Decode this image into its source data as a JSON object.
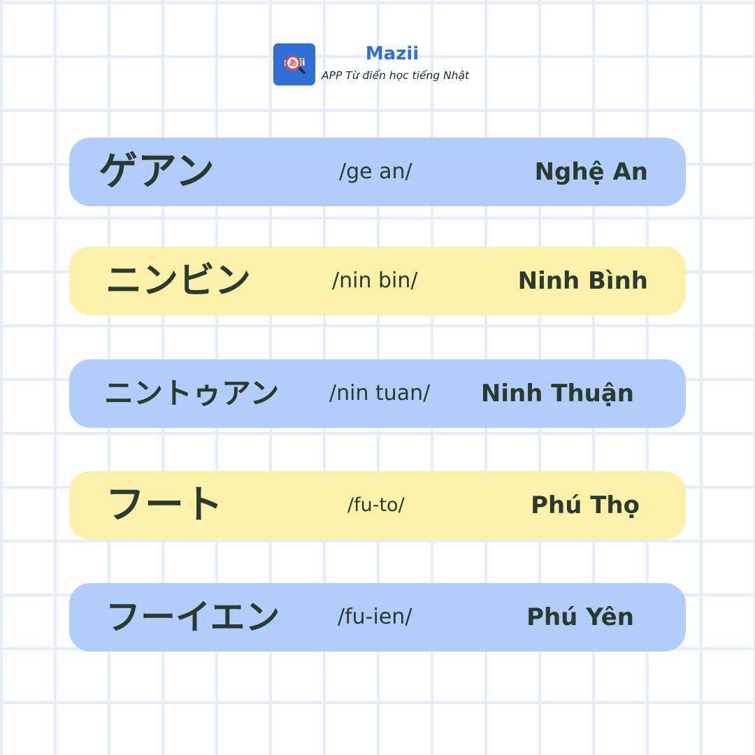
{
  "header": {
    "logo_text": "mzii",
    "logo_char": "あ",
    "brand": "Mazii",
    "tagline": "APP Từ điển học tiếng Nhật"
  },
  "colors": {
    "blue_card": "#b3cdfb",
    "yellow_card": "#fdf1a9",
    "text": "#2a3a2e",
    "brand": "#2f6fd6"
  },
  "rows": [
    {
      "japanese": "ゲアン",
      "romaji": "/ge an/",
      "vietnamese": "Nghệ An"
    },
    {
      "japanese": "ニンビン",
      "romaji": "/nin bin/",
      "vietnamese": "Ninh Bình"
    },
    {
      "japanese": "ニントゥアン",
      "romaji": "/nin tuan/",
      "vietnamese": "Ninh Thuận"
    },
    {
      "japanese": "フート",
      "romaji": "/fu-to/",
      "vietnamese": "Phú Thọ"
    },
    {
      "japanese": "フーイエン",
      "romaji": "/fu-ien/",
      "vietnamese": "Phú Yên"
    }
  ]
}
